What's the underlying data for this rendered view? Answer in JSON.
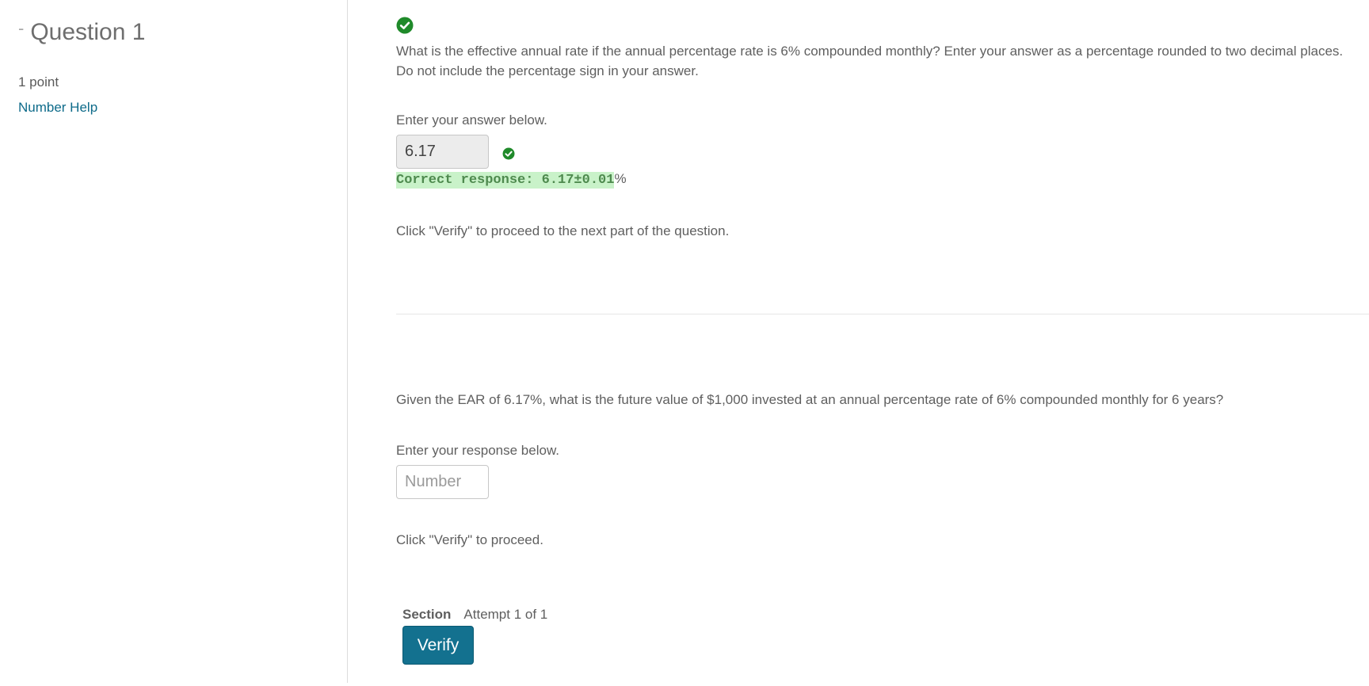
{
  "sidebar": {
    "collapse_symbol": "-",
    "title": "Question 1",
    "points": "1 point",
    "help_link": "Number Help"
  },
  "part1": {
    "question": "What is the effective annual rate if the annual percentage rate is 6% compounded monthly? Enter your answer as a percentage rounded to two decimal places. Do not include the percentage sign in your answer.",
    "prompt": "Enter your answer below.",
    "answer_value": "6.17",
    "correct_response": "Correct response: 6.17±0.01",
    "correct_unit": "%",
    "instruction": "Click \"Verify\" to proceed to the next part of the question."
  },
  "part2": {
    "question": "Given the EAR of 6.17%, what is the future value of $1,000 invested at an annual percentage rate of 6% compounded monthly for 6 years?",
    "prompt": "Enter your response below.",
    "placeholder": "Number",
    "instruction": "Click \"Verify\" to proceed."
  },
  "footer": {
    "section_label": "Section",
    "attempt": "Attempt 1 of 1",
    "verify_label": "Verify"
  },
  "colors": {
    "accent": "#13718f",
    "link": "#0e6b8a",
    "success": "#1f8a2a",
    "correct_highlight": "#c9f2c9"
  },
  "icons": {
    "status": "check-circle-icon"
  }
}
